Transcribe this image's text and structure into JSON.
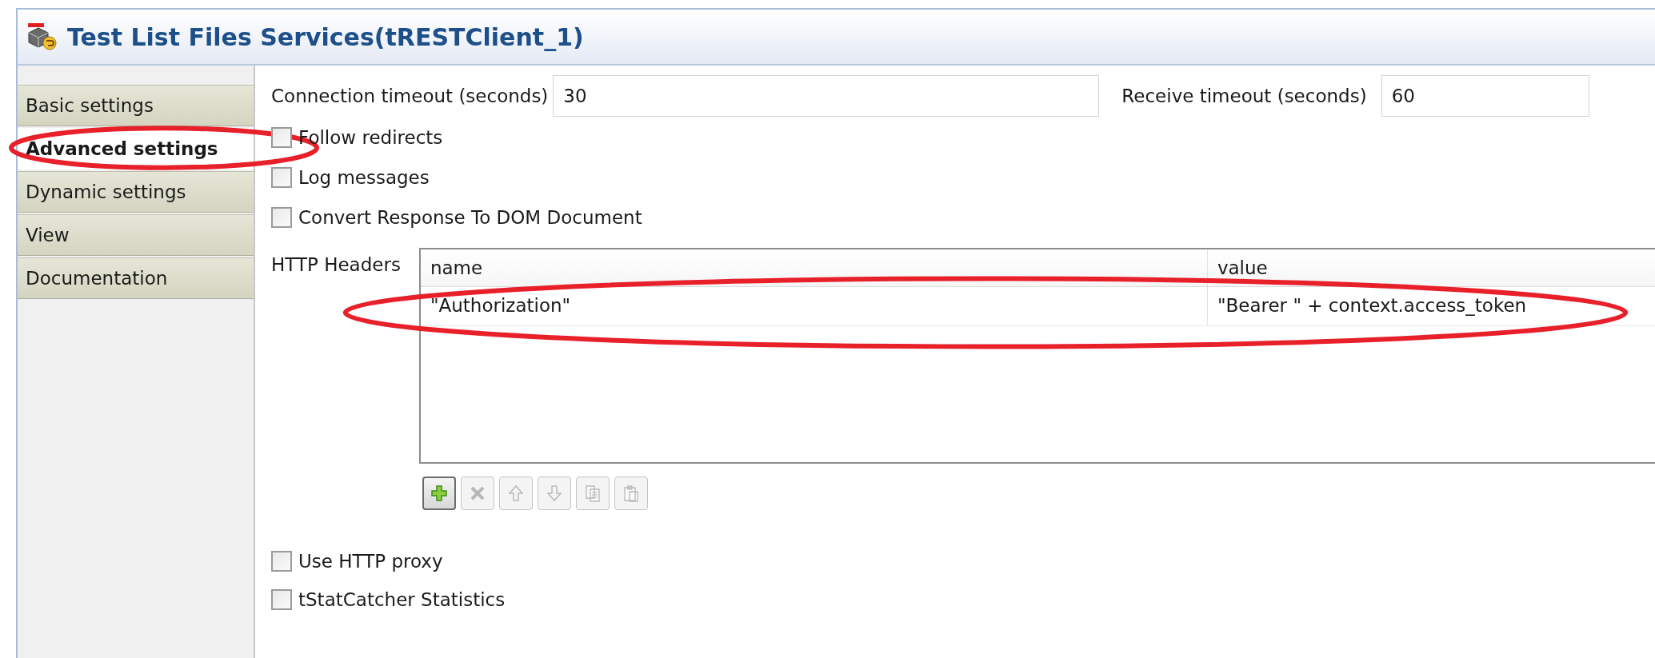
{
  "window": {
    "title": "Test List Files Services(tRESTClient_1)"
  },
  "tabs": [
    {
      "label": "Basic settings",
      "selected": false,
      "circled": false
    },
    {
      "label": "Advanced settings",
      "selected": true,
      "circled": true
    },
    {
      "label": "Dynamic settings",
      "selected": false,
      "circled": false
    },
    {
      "label": "View",
      "selected": false,
      "circled": false
    },
    {
      "label": "Documentation",
      "selected": false,
      "circled": false
    }
  ],
  "timeouts": [
    {
      "label": "Connection timeout (seconds)",
      "value": "30"
    },
    {
      "label": "Receive timeout (seconds)",
      "value": "60"
    }
  ],
  "options": [
    {
      "label": "Follow redirects",
      "checked": false
    },
    {
      "label": "Log messages",
      "checked": false
    },
    {
      "label": "Convert Response To DOM Document",
      "checked": false
    }
  ],
  "headers": {
    "label": "HTTP Headers",
    "columns": [
      "name",
      "value"
    ],
    "rows": [
      {
        "cells": [
          "\"Authorization\"",
          "\"Bearer \" + context.access_token"
        ],
        "circled": true
      }
    ],
    "toolbar": [
      {
        "kind": "add",
        "disabled": false
      },
      {
        "kind": "delete",
        "disabled": true
      },
      {
        "kind": "up",
        "disabled": true
      },
      {
        "kind": "down",
        "disabled": true
      },
      {
        "kind": "copy",
        "disabled": true
      },
      {
        "kind": "paste",
        "disabled": true
      }
    ]
  },
  "bottom_options": [
    {
      "label": "Use HTTP proxy",
      "checked": false
    },
    {
      "label": "tStatCatcher Statistics",
      "checked": false
    }
  ]
}
